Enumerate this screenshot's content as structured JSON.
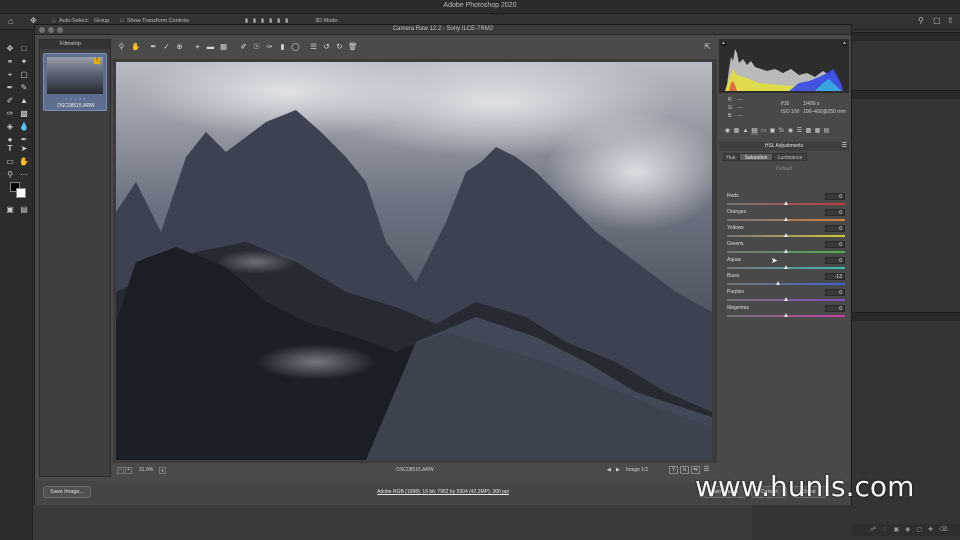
{
  "ps": {
    "app_title": "Adobe Photoshop 2020",
    "options": {
      "auto_select": "Auto-Select:",
      "layer_mode": "Group",
      "show_transform": "Show Transform Controls",
      "mode_label": "3D Mode:"
    }
  },
  "camera_raw": {
    "title": "Camera Raw 12.2  -  Sony ILCE-7RM2",
    "filmstrip": {
      "header": "Filmstrip",
      "item": {
        "filename": "DSC08515.ARW",
        "stars": "• • • • •"
      }
    },
    "status": {
      "zoom": "31.9%",
      "filename": "DSC08515.ARW",
      "image_counter": "Image 1/1"
    },
    "bottom": {
      "save_label": "Save Image...",
      "workflow_link": "Adobe RGB (1998); 16 bit; 7952 by 5304 (42.2MP); 300 ppi",
      "open_label": "Open Image",
      "cancel_label": "Cancel",
      "done_label": "Done"
    },
    "info": {
      "r_label": "R:",
      "g_label": "G:",
      "b_label": "B:",
      "rgb_value": "---",
      "aperture": "f/16",
      "shutter": "1/400 s",
      "iso": "ISO 100",
      "lens": "100–400@250 mm"
    },
    "hsl": {
      "header": "HSL Adjustments",
      "tabs": [
        "Hue",
        "Saturation",
        "Luminance"
      ],
      "active_tab": "Saturation",
      "default_link": "Default",
      "sliders": [
        {
          "label": "Reds",
          "value": "0",
          "level": 0,
          "color": "#c43838"
        },
        {
          "label": "Oranges",
          "value": "0",
          "level": 0,
          "color": "#d7803a"
        },
        {
          "label": "Yellows",
          "value": "0",
          "level": 0,
          "color": "#d6c33b"
        },
        {
          "label": "Greens",
          "value": "0",
          "level": 0,
          "color": "#4cb04c"
        },
        {
          "label": "Aquas",
          "value": "0",
          "level": 0,
          "color": "#3fb7b7"
        },
        {
          "label": "Blues",
          "value": "-13",
          "level": -13,
          "color": "#3a64d0"
        },
        {
          "label": "Purples",
          "value": "0",
          "level": 0,
          "color": "#8a48c8"
        },
        {
          "label": "Magentas",
          "value": "0",
          "level": 0,
          "color": "#c43aa8"
        }
      ]
    }
  },
  "watermark": "www.hunls.com"
}
